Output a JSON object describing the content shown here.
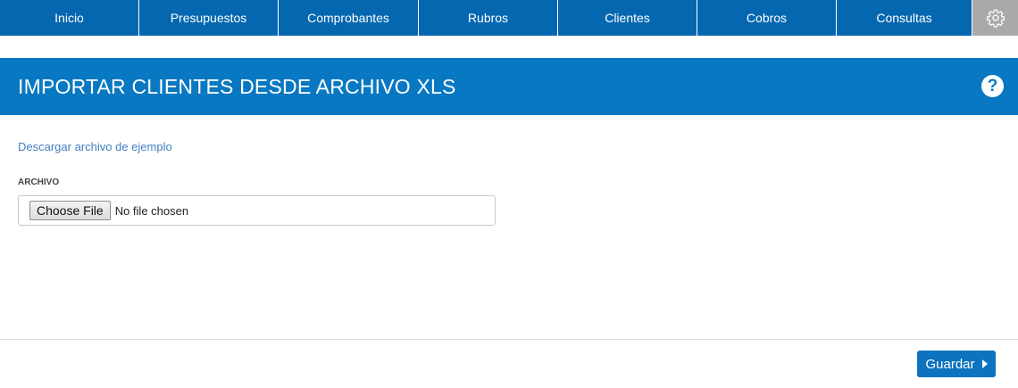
{
  "nav": {
    "items": [
      {
        "label": "Inicio"
      },
      {
        "label": "Presupuestos"
      },
      {
        "label": "Comprobantes"
      },
      {
        "label": "Rubros"
      },
      {
        "label": "Clientes"
      },
      {
        "label": "Cobros"
      },
      {
        "label": "Consultas"
      }
    ],
    "settings_icon": "gear-icon"
  },
  "header": {
    "title": "IMPORTAR CLIENTES DESDE ARCHIVO XLS",
    "help_label": "?"
  },
  "main": {
    "download_link": "Descargar archivo de ejemplo",
    "file_label": "ARCHIVO",
    "choose_button": "Choose File",
    "file_status": "No file chosen"
  },
  "footer": {
    "save_label": "Guardar"
  },
  "colors": {
    "nav_bg": "#0567b0",
    "header_bg": "#0978c2",
    "settings_bg": "#a7a9ab",
    "link": "#3f7fbf",
    "button_bg": "#0d73be"
  }
}
